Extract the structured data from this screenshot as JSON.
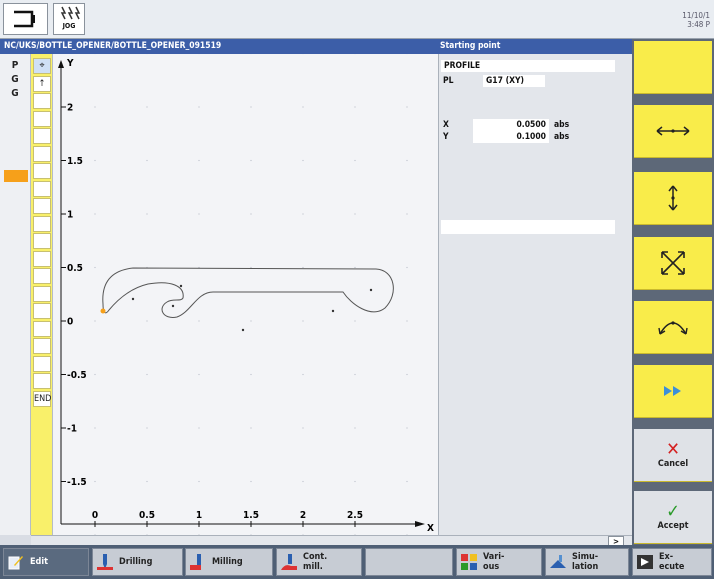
{
  "header": {
    "mode_label": "JOG",
    "clock_line1": "11/10/1",
    "clock_line2": "3:48 P"
  },
  "title": {
    "path": "NC/UKS/BOTTLE_OPENER/BOTTLE_OPENER_091519",
    "form_title": "Starting point"
  },
  "contour_types": [
    "P",
    "G",
    "G",
    "",
    "",
    "",
    "",
    "",
    "",
    "",
    "",
    "",
    "",
    "",
    "",
    "",
    "",
    "",
    "",
    "",
    "",
    "",
    "",
    "",
    "",
    "",
    "",
    "",
    "",
    "",
    "",
    "",
    "",
    ""
  ],
  "element_strip": [
    "⌖",
    "↑",
    "",
    "",
    "",
    "",
    "",
    "",
    "",
    "",
    "",
    "",
    "",
    "",
    "",
    "",
    "",
    "",
    "",
    "END"
  ],
  "graphic": {
    "y_axis_label": "Y",
    "x_axis_label": "X",
    "y_ticks": [
      "2",
      "1.5",
      "1",
      "0.5",
      "0",
      "-0.5",
      "-1",
      "-1.5"
    ],
    "x_ticks": [
      "0",
      "0.5",
      "1",
      "1.5",
      "2",
      "2.5"
    ],
    "y_values": [
      2,
      1.5,
      1,
      0.5,
      0,
      -0.5,
      -1,
      -1.5
    ],
    "x_values": [
      0,
      0.5,
      1,
      1.5,
      2,
      2.5
    ]
  },
  "form": {
    "profile_label": "PROFILE",
    "pl_label": "PL",
    "pl_value": "G17 (XY)",
    "x_label": "X",
    "x_value": "0.0500",
    "x_unit": "abs",
    "y_label": "Y",
    "y_value": "0.1000",
    "y_unit": "abs"
  },
  "softkeys_vertical": [
    {
      "id": "sk1",
      "label": "",
      "icon": "blank"
    },
    {
      "id": "sk2",
      "label": "",
      "icon": "horizontal-arrow-icon"
    },
    {
      "id": "sk3",
      "label": "",
      "icon": "vertical-arrow-icon"
    },
    {
      "id": "sk4",
      "label": "",
      "icon": "diagonal-arrows-icon"
    },
    {
      "id": "sk5",
      "label": "",
      "icon": "arc-icon"
    },
    {
      "id": "sk6",
      "label": "",
      "icon": "fast-forward-icon"
    },
    {
      "id": "cancel",
      "label": "Cancel",
      "icon": "cancel-icon"
    },
    {
      "id": "accept",
      "label": "Accept",
      "icon": "checkmark-icon"
    }
  ],
  "softkeys_horizontal": {
    "edit": "Edit",
    "drilling": "Drilling",
    "milling": "Milling",
    "cont_mill_1": "Cont.",
    "cont_mill_2": "mill.",
    "various_1": "Vari-",
    "various_2": "ous",
    "simulation_1": "Simu-",
    "simulation_2": "lation",
    "execute_1": "Ex-",
    "execute_2": "ecute"
  },
  "scroll_arrow": ">",
  "colors": {
    "title_bar": "#3c5ea8",
    "softkey_yellow": "#f9ec4a",
    "selection_orange": "#f6a01a",
    "cancel_red": "#d42020",
    "accept_green": "#2a9a2a"
  }
}
